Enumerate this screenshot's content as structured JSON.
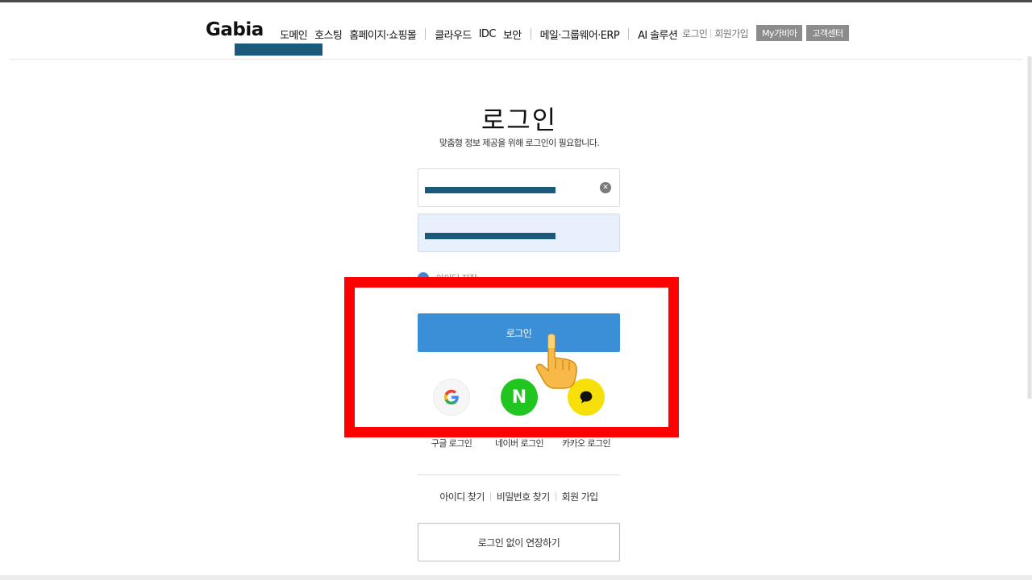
{
  "header": {
    "logo": "Gabia",
    "nav": [
      {
        "label": "도메인"
      },
      {
        "label": "호스팅"
      },
      {
        "label": "홈페이지·쇼핑몰",
        "sep_after": true
      },
      {
        "label": "클라우드"
      },
      {
        "label": "IDC"
      },
      {
        "label": "보안",
        "sep_after": true
      },
      {
        "label": "메일·그룹웨어·ERP",
        "sep_after": true
      },
      {
        "label": "AI 솔루션"
      }
    ],
    "utility": {
      "login": "로그인",
      "signup": "회원가입",
      "my_gabia": "My가비아",
      "support": "고객센터"
    }
  },
  "login": {
    "title": "로그인",
    "subtitle": "맞춤형 정보 제공을 위해 로그인이 필요합니다.",
    "id_value": "",
    "password_value": "",
    "clear_icon": "close-icon",
    "remember_label": "아이디 저장",
    "submit_label": "로그인",
    "social": {
      "google_label": "구글 로그인",
      "naver_label": "네이버 로그인",
      "naver_mark": "N",
      "kakao_label": "카카오 로그인"
    },
    "links": {
      "find_id": "아이디 찾기",
      "find_password": "비밀번호 찾기",
      "signup": "회원 가입"
    },
    "extend_label": "로그인 없이 연장하기"
  },
  "colors": {
    "primary": "#3a8fd6",
    "naver": "#21c520",
    "kakao": "#f7df0a",
    "highlight": "#ff0000",
    "redaction": "#1b5a7a"
  }
}
